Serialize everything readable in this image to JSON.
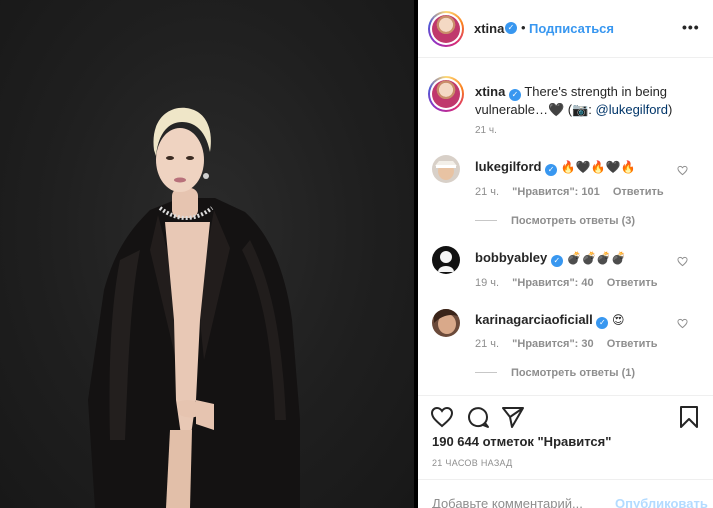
{
  "post": {
    "username": "xtina",
    "follow_label": "Подписаться",
    "dot": "•",
    "more_label": "•••",
    "caption_text": "There's strength in being vulnerable…🖤 (📷: ",
    "caption_mention": "@lukegilford",
    "caption_close": ")",
    "caption_time": "21 ч."
  },
  "comments": [
    {
      "username": "lukegilford",
      "text": "🔥🖤🔥🖤🔥",
      "time": "21 ч.",
      "likes": "\"Нравится\": 101",
      "reply": "Ответить",
      "view_replies": "Посмотреть ответы (3)"
    },
    {
      "username": "bobbyabley",
      "text": "💣💣💣💣",
      "time": "19 ч.",
      "likes": "\"Нравится\": 40",
      "reply": "Ответить"
    },
    {
      "username": "karinagarciaoficiall",
      "text": "😍",
      "time": "21 ч.",
      "likes": "\"Нравится\": 30",
      "reply": "Ответить",
      "view_replies": "Посмотреть ответы (1)"
    }
  ],
  "actions": {
    "like_icon": "heart-icon",
    "comment_icon": "comment-icon",
    "share_icon": "paper-plane-icon",
    "save_icon": "bookmark-icon",
    "likes_total": "190 644 отметок \"Нравится\"",
    "post_time": "21 ЧАСОВ НАЗАД"
  },
  "comment_box": {
    "placeholder": "Добавьте комментарий...",
    "publish_label": "Опубликовать"
  },
  "colors": {
    "link": "#3897f0",
    "muted": "#8e8e8e",
    "publish_disabled": "#b3dbff",
    "verified": "#3897f0"
  }
}
